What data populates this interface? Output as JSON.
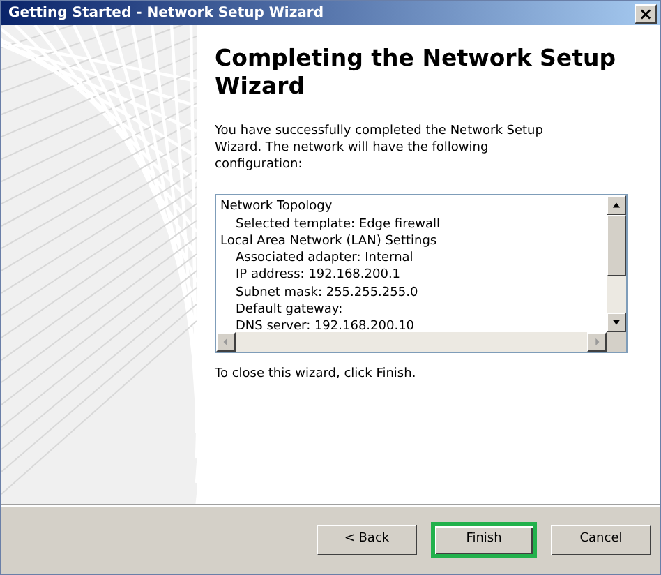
{
  "window": {
    "title": "Getting Started - Network Setup Wizard",
    "close": "×"
  },
  "heading": "Completing the Network Setup Wizard",
  "intro": "You have successfully completed the Network Setup Wizard. The network will have the following configuration:",
  "configuration": [
    {
      "text": "Network Topology",
      "children": [
        {
          "text": "Selected template: Edge firewall"
        }
      ]
    },
    {
      "text": "Local Area Network (LAN) Settings",
      "children": [
        {
          "text": "Associated adapter: Internal"
        },
        {
          "text": "IP address: 192.168.200.1"
        },
        {
          "text": "Subnet mask: 255.255.255.0"
        },
        {
          "text": "Default gateway:"
        },
        {
          "text": "DNS server: 192.168.200.10"
        }
      ]
    }
  ],
  "closing": "To close this wizard, click Finish.",
  "buttons": [
    {
      "label": "< Back",
      "highlighted": false
    },
    {
      "label": "Finish",
      "highlighted": true
    },
    {
      "label": "Cancel",
      "highlighted": false
    }
  ]
}
